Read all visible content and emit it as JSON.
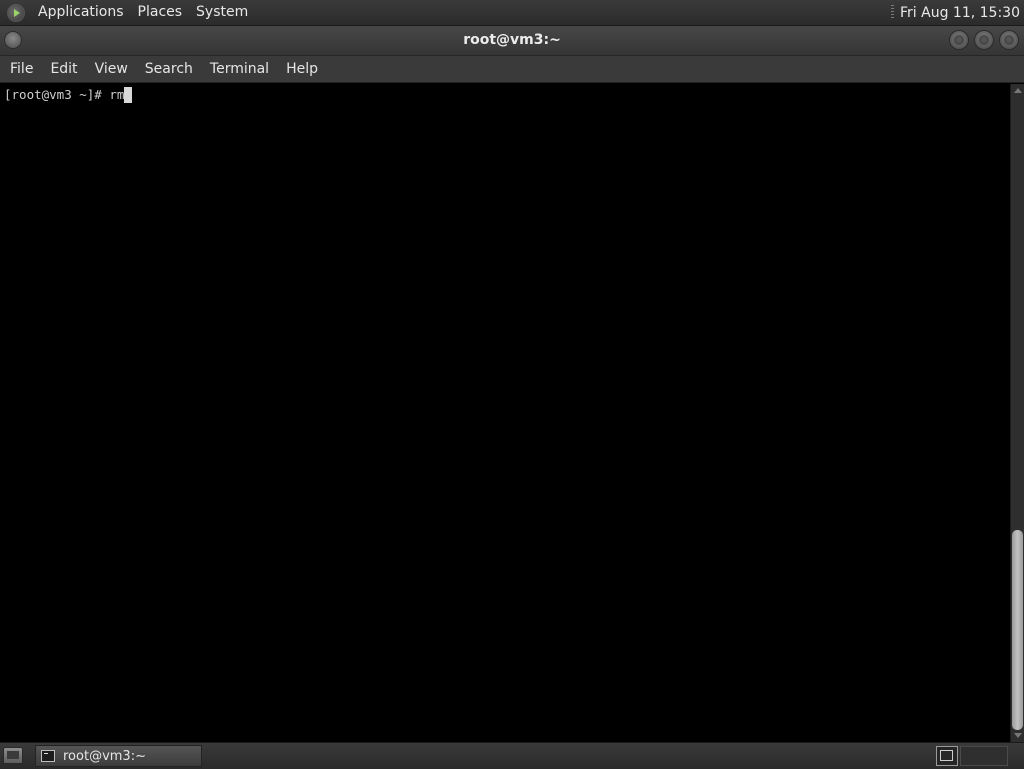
{
  "top_panel": {
    "menus": [
      "Applications",
      "Places",
      "System"
    ],
    "clock": "Fri Aug 11, 15:30"
  },
  "window": {
    "title": "root@vm3:~"
  },
  "menubar": {
    "items": [
      "File",
      "Edit",
      "View",
      "Search",
      "Terminal",
      "Help"
    ]
  },
  "terminal": {
    "prompt": "[root@vm3 ~]# ",
    "command": "rm"
  },
  "taskbar": {
    "window_label": "root@vm3:~"
  }
}
